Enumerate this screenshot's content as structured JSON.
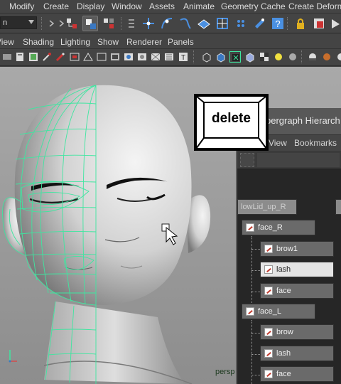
{
  "menubar": {
    "items": [
      "Modify",
      "Create",
      "Display",
      "Window",
      "Assets",
      "Animate",
      "Geometry Cache",
      "Create Deform"
    ]
  },
  "statusline": {
    "mode_value": "n"
  },
  "panel_menu": {
    "items": [
      "View",
      "Shading",
      "Lighting",
      "Show",
      "Renderer",
      "Panels"
    ]
  },
  "viewport": {
    "camera_label": "persp"
  },
  "hypergraph": {
    "title": "pergraph Hierarch",
    "menu": [
      "View",
      "Bookmarks"
    ],
    "nodes": {
      "ghost": "lowLid_up_R",
      "face_R": "face_R",
      "brow1": "brow1",
      "lash_R": "lash",
      "face_R_child": "face",
      "face_L": "face_L",
      "brow_L": "brow",
      "lash_L": "lash",
      "face_L_child": "face"
    }
  },
  "overlay": {
    "key_label": "delete"
  },
  "colors": {
    "wire": "#3ee6a0",
    "selected_node": "#e4e4e4",
    "accent_toolbar": "#3a78c2"
  }
}
